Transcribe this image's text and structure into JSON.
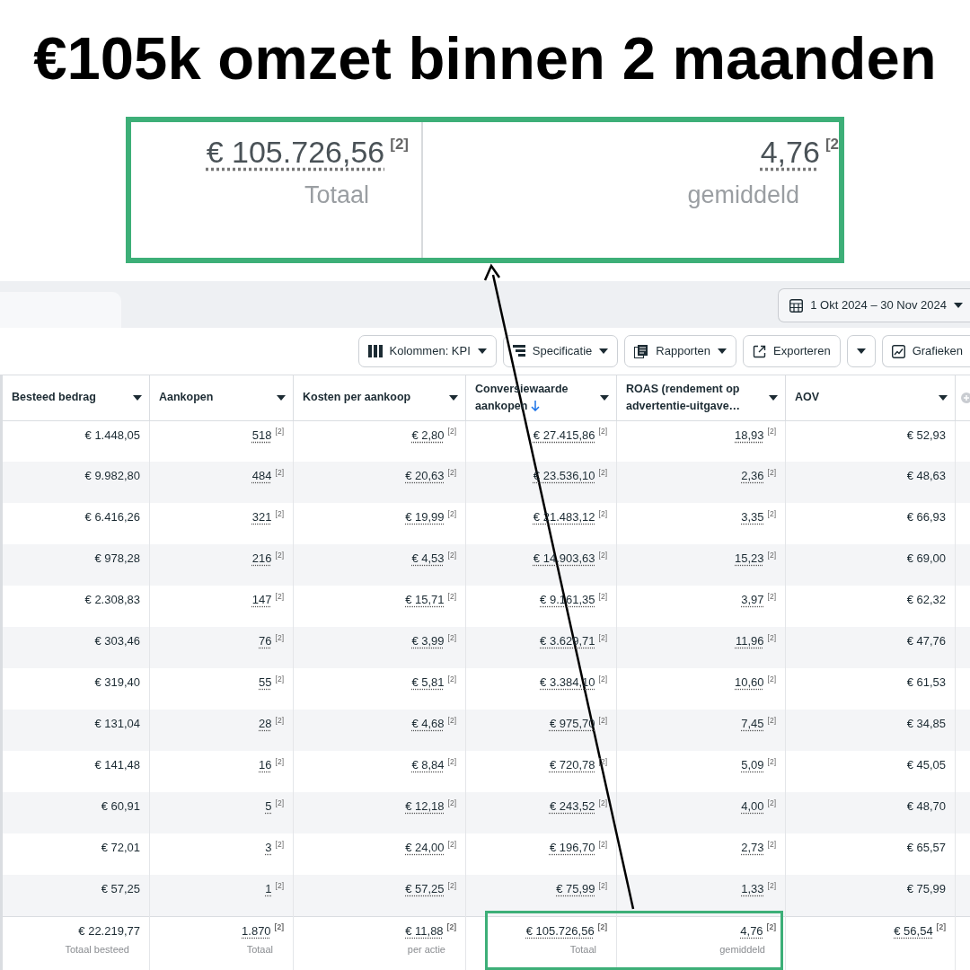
{
  "headline": "€105k omzet binnen 2 maanden",
  "callout": {
    "cells": [
      {
        "value": "€ 105.726,56",
        "note": "[2]",
        "caption": "Totaal"
      },
      {
        "value": "4,76",
        "note": "[2",
        "caption": "gemiddeld"
      }
    ]
  },
  "date_range": "1 Okt 2024 – 30 Nov 2024",
  "toolbar": [
    {
      "kind": "button",
      "label": "Kolommen: KPI",
      "dropdown": true
    },
    {
      "kind": "button",
      "label": "Specificatie",
      "dropdown": true
    },
    {
      "kind": "button",
      "label": "Rapporten",
      "dropdown": true
    },
    {
      "kind": "button",
      "label": "Exporteren",
      "dropdown": false
    },
    {
      "kind": "split-caret"
    },
    {
      "kind": "button",
      "label": "Grafieken",
      "dropdown": false
    }
  ],
  "table": {
    "columns": [
      {
        "label": "Besteed bedrag",
        "sorted": false
      },
      {
        "label": "Aankopen",
        "sorted": false
      },
      {
        "label": "Kosten per aankoop",
        "sorted": false
      },
      {
        "label": "Conversiewaarde aankopen",
        "sorted": true
      },
      {
        "label": "ROAS (rendement op advertentie-uitgave…",
        "sorted": false
      },
      {
        "label": "AOV",
        "sorted": false
      }
    ],
    "rows": [
      [
        {
          "value": "€ 1.448,05"
        },
        {
          "value": "518",
          "note": "[2]"
        },
        {
          "value": "€ 2,80",
          "note": "[2]"
        },
        {
          "value": "€ 27.415,86",
          "note": "[2]"
        },
        {
          "value": "18,93",
          "note": "[2]"
        },
        {
          "value": "€ 52,93"
        }
      ],
      [
        {
          "value": "€ 9.982,80"
        },
        {
          "value": "484",
          "note": "[2]"
        },
        {
          "value": "€ 20,63",
          "note": "[2]"
        },
        {
          "value": "€ 23.536,10",
          "note": "[2]"
        },
        {
          "value": "2,36",
          "note": "[2]"
        },
        {
          "value": "€ 48,63"
        }
      ],
      [
        {
          "value": "€ 6.416,26"
        },
        {
          "value": "321",
          "note": "[2]"
        },
        {
          "value": "€ 19,99",
          "note": "[2]"
        },
        {
          "value": "€ 21.483,12",
          "note": "[2]"
        },
        {
          "value": "3,35",
          "note": "[2]"
        },
        {
          "value": "€ 66,93"
        }
      ],
      [
        {
          "value": "€ 978,28"
        },
        {
          "value": "216",
          "note": "[2]"
        },
        {
          "value": "€ 4,53",
          "note": "[2]"
        },
        {
          "value": "€ 14.903,63",
          "note": "[2]"
        },
        {
          "value": "15,23",
          "note": "[2]"
        },
        {
          "value": "€ 69,00"
        }
      ],
      [
        {
          "value": "€ 2.308,83"
        },
        {
          "value": "147",
          "note": "[2]"
        },
        {
          "value": "€ 15,71",
          "note": "[2]"
        },
        {
          "value": "€ 9.161,35",
          "note": "[2]"
        },
        {
          "value": "3,97",
          "note": "[2]"
        },
        {
          "value": "€ 62,32"
        }
      ],
      [
        {
          "value": "€ 303,46"
        },
        {
          "value": "76",
          "note": "[2]"
        },
        {
          "value": "€ 3,99",
          "note": "[2]"
        },
        {
          "value": "€ 3.629,71",
          "note": "[2]"
        },
        {
          "value": "11,96",
          "note": "[2]"
        },
        {
          "value": "€ 47,76"
        }
      ],
      [
        {
          "value": "€ 319,40"
        },
        {
          "value": "55",
          "note": "[2]"
        },
        {
          "value": "€ 5,81",
          "note": "[2]"
        },
        {
          "value": "€ 3.384,10",
          "note": "[2]"
        },
        {
          "value": "10,60",
          "note": "[2]"
        },
        {
          "value": "€ 61,53"
        }
      ],
      [
        {
          "value": "€ 131,04"
        },
        {
          "value": "28",
          "note": "[2]"
        },
        {
          "value": "€ 4,68",
          "note": "[2]"
        },
        {
          "value": "€ 975,70",
          "note": "[2]"
        },
        {
          "value": "7,45",
          "note": "[2]"
        },
        {
          "value": "€ 34,85"
        }
      ],
      [
        {
          "value": "€ 141,48"
        },
        {
          "value": "16",
          "note": "[2]"
        },
        {
          "value": "€ 8,84",
          "note": "[2]"
        },
        {
          "value": "€ 720,78",
          "note": "[2]"
        },
        {
          "value": "5,09",
          "note": "[2]"
        },
        {
          "value": "€ 45,05"
        }
      ],
      [
        {
          "value": "€ 60,91"
        },
        {
          "value": "5",
          "note": "[2]"
        },
        {
          "value": "€ 12,18",
          "note": "[2]"
        },
        {
          "value": "€ 243,52",
          "note": "[2]"
        },
        {
          "value": "4,00",
          "note": "[2]"
        },
        {
          "value": "€ 48,70"
        }
      ],
      [
        {
          "value": "€ 72,01"
        },
        {
          "value": "3",
          "note": "[2]"
        },
        {
          "value": "€ 24,00",
          "note": "[2]"
        },
        {
          "value": "€ 196,70",
          "note": "[2]"
        },
        {
          "value": "2,73",
          "note": "[2]"
        },
        {
          "value": "€ 65,57"
        }
      ],
      [
        {
          "value": "€ 57,25"
        },
        {
          "value": "1",
          "note": "[2]"
        },
        {
          "value": "€ 57,25",
          "note": "[2]"
        },
        {
          "value": "€ 75,99",
          "note": "[2]"
        },
        {
          "value": "1,33",
          "note": "[2]"
        },
        {
          "value": "€ 75,99"
        }
      ]
    ],
    "totals": [
      {
        "value": "€ 22.219,77",
        "caption": "Totaal besteed"
      },
      {
        "value": "1.870",
        "note": "[2]",
        "caption": "Totaal"
      },
      {
        "value": "€ 11,88",
        "note": "[2]",
        "caption": "per actie"
      },
      {
        "value": "€ 105.726,56",
        "note": "[2]",
        "caption": "Totaal"
      },
      {
        "value": "4,76",
        "note": "[2]",
        "caption": "gemiddeld"
      },
      {
        "value": "€ 56,54",
        "note": "[2]"
      }
    ]
  }
}
